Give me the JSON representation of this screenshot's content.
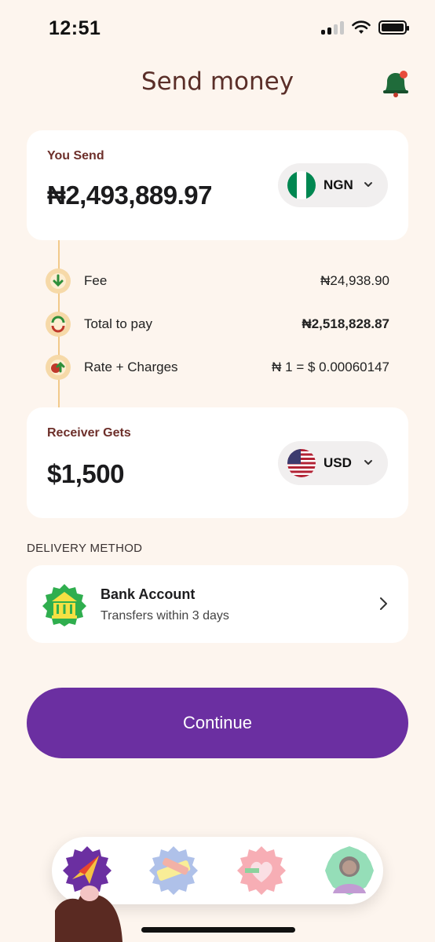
{
  "status": {
    "time": "12:51"
  },
  "header": {
    "title": "Send money",
    "bell_icon": "bell-icon"
  },
  "send": {
    "label": "You Send",
    "amount": "₦2,493,889.97",
    "currency": "NGN",
    "flag_icon": "nigeria-flag-icon"
  },
  "details": [
    {
      "label": "Fee",
      "value": "₦24,938.90",
      "icon": "fee-icon"
    },
    {
      "label": "Total to pay",
      "value": "₦2,518,828.87",
      "icon": "total-icon"
    },
    {
      "label": "Rate + Charges",
      "value": "₦ 1 = $ 0.00060147",
      "icon": "rate-icon"
    }
  ],
  "receive": {
    "label": "Receiver Gets",
    "amount": "$1,500",
    "currency": "USD",
    "flag_icon": "usa-flag-icon"
  },
  "delivery": {
    "section_title": "DELIVERY METHOD",
    "title": "Bank Account",
    "subtitle": "Transfers within 3 days",
    "icon": "bank-icon"
  },
  "actions": {
    "continue_label": "Continue"
  },
  "tabs": [
    {
      "icon": "send-tab-icon",
      "active": true
    },
    {
      "icon": "cards-tab-icon",
      "active": false
    },
    {
      "icon": "gift-tab-icon",
      "active": false
    },
    {
      "icon": "profile-tab-icon",
      "active": false
    }
  ],
  "colors": {
    "background": "#fdf5ee",
    "primary": "#6b2fa1",
    "title": "#5a2e28",
    "label": "#6d2f2a",
    "timeline": "#f1c98b"
  }
}
